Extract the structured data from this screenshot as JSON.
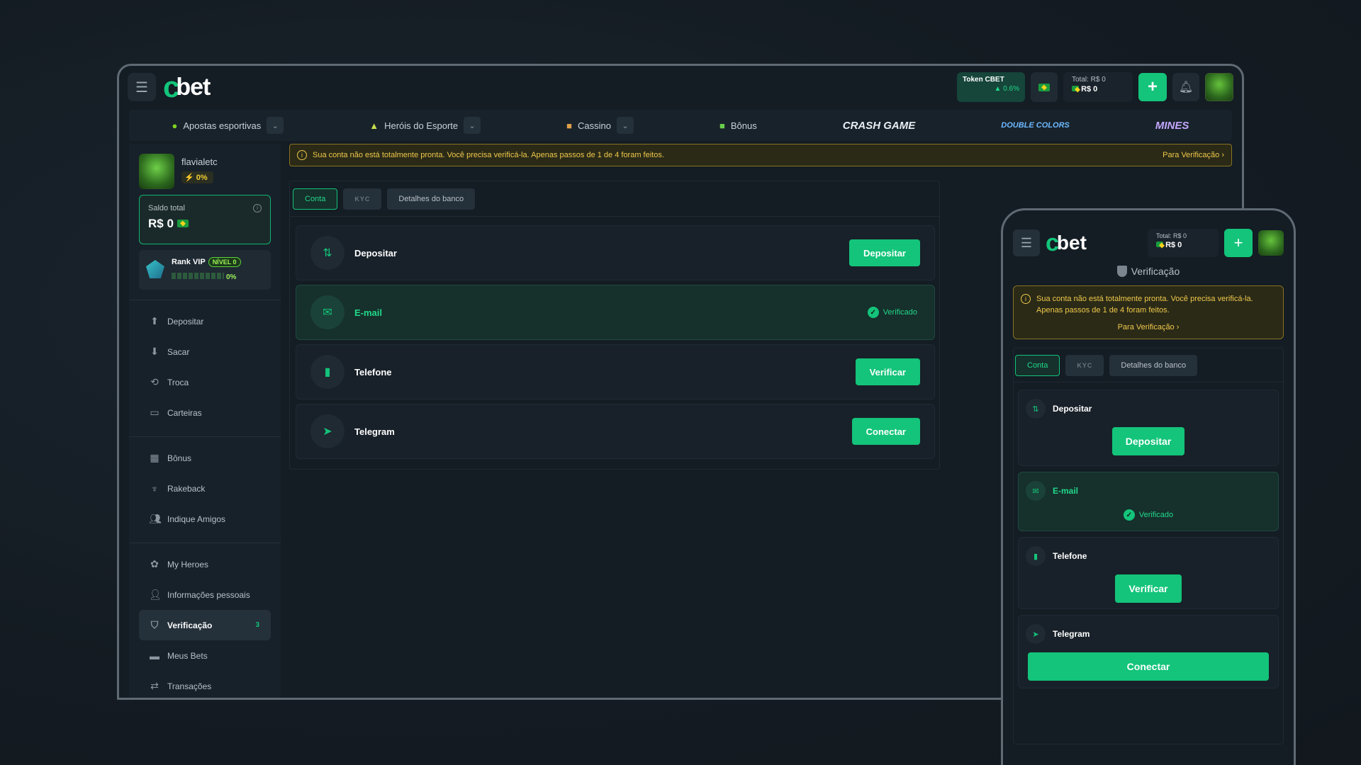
{
  "desktop": {
    "logo_text": "bet",
    "token": {
      "label": "Token CBET",
      "change": "▲ 0.6%"
    },
    "total": {
      "label": "Total: R$ 0",
      "value": "R$ 0"
    },
    "nav": [
      {
        "label": "Apostas esportivas",
        "icon": "soccer-ball-icon",
        "dropdown": true
      },
      {
        "label": "Heróis do Esporte",
        "icon": "hero-icon",
        "dropdown": true
      },
      {
        "label": "Cassino",
        "icon": "dice-icon",
        "dropdown": true
      },
      {
        "label": "Bônus",
        "icon": "gift-icon",
        "dropdown": false
      }
    ],
    "brands": [
      "CRASH GAME",
      "DOUBLE COLORS",
      "MINES"
    ],
    "profile": {
      "username": "flavialetc",
      "level_pct": "0%"
    },
    "saldo": {
      "label": "Saldo total",
      "value": "R$ 0"
    },
    "vip": {
      "label": "Rank VIP",
      "nivel": "NÍVEL 0",
      "progress_pct": "0%",
      "progress_fraction": 0
    },
    "menu_group1": [
      {
        "label": "Depositar",
        "icon": "arrow-up-icon"
      },
      {
        "label": "Sacar",
        "icon": "arrow-down-icon"
      },
      {
        "label": "Troca",
        "icon": "swap-icon"
      },
      {
        "label": "Carteiras",
        "icon": "wallet-icon"
      }
    ],
    "menu_group2": [
      {
        "label": "Bônus",
        "icon": "gift-icon"
      },
      {
        "label": "Rakeback",
        "icon": "rakeback-icon"
      },
      {
        "label": "Indique Amigos",
        "icon": "users-icon"
      }
    ],
    "menu_group3": [
      {
        "label": "My Heroes",
        "icon": "heroes-icon"
      },
      {
        "label": "Informações pessoais",
        "icon": "user-icon"
      },
      {
        "label": "Verificação",
        "icon": "shield-icon",
        "badge": "3",
        "active": true
      },
      {
        "label": "Meus Bets",
        "icon": "ticket-icon"
      },
      {
        "label": "Transações",
        "icon": "transactions-icon"
      }
    ],
    "alert": {
      "text": "Sua conta não está totalmente pronta. Você precisa verificá-la. Apenas passos de 1 de 4 foram feitos.",
      "link": "Para Verificação"
    },
    "tabs": [
      "Conta",
      "KYC",
      "Detalhes do banco"
    ],
    "rows": [
      {
        "label": "Depositar",
        "action": "Depositar",
        "icon": "transfer-icon"
      },
      {
        "label": "E-mail",
        "status": "Verificado",
        "icon": "mail-icon"
      },
      {
        "label": "Telefone",
        "action": "Verificar",
        "icon": "phone-icon"
      },
      {
        "label": "Telegram",
        "action": "Conectar",
        "icon": "telegram-icon"
      }
    ]
  },
  "mobile": {
    "logo_text": "bet",
    "total": {
      "label": "Total: R$ 0",
      "value": "R$ 0"
    },
    "title": "Verificação",
    "alert": {
      "text": "Sua conta não está totalmente pronta. Você precisa verificá-la. Apenas passos de 1 de 4 foram feitos.",
      "link": "Para Verificação"
    },
    "tabs": [
      "Conta",
      "KYC",
      "Detalhes do banco"
    ],
    "rows": [
      {
        "label": "Depositar",
        "action": "Depositar"
      },
      {
        "label": "E-mail",
        "status": "Verificado"
      },
      {
        "label": "Telefone",
        "action": "Verificar"
      },
      {
        "label": "Telegram",
        "action": "Conectar"
      }
    ]
  },
  "colors": {
    "accent": "#13c47a",
    "warning": "#f0c84a",
    "background": "#141c24"
  }
}
